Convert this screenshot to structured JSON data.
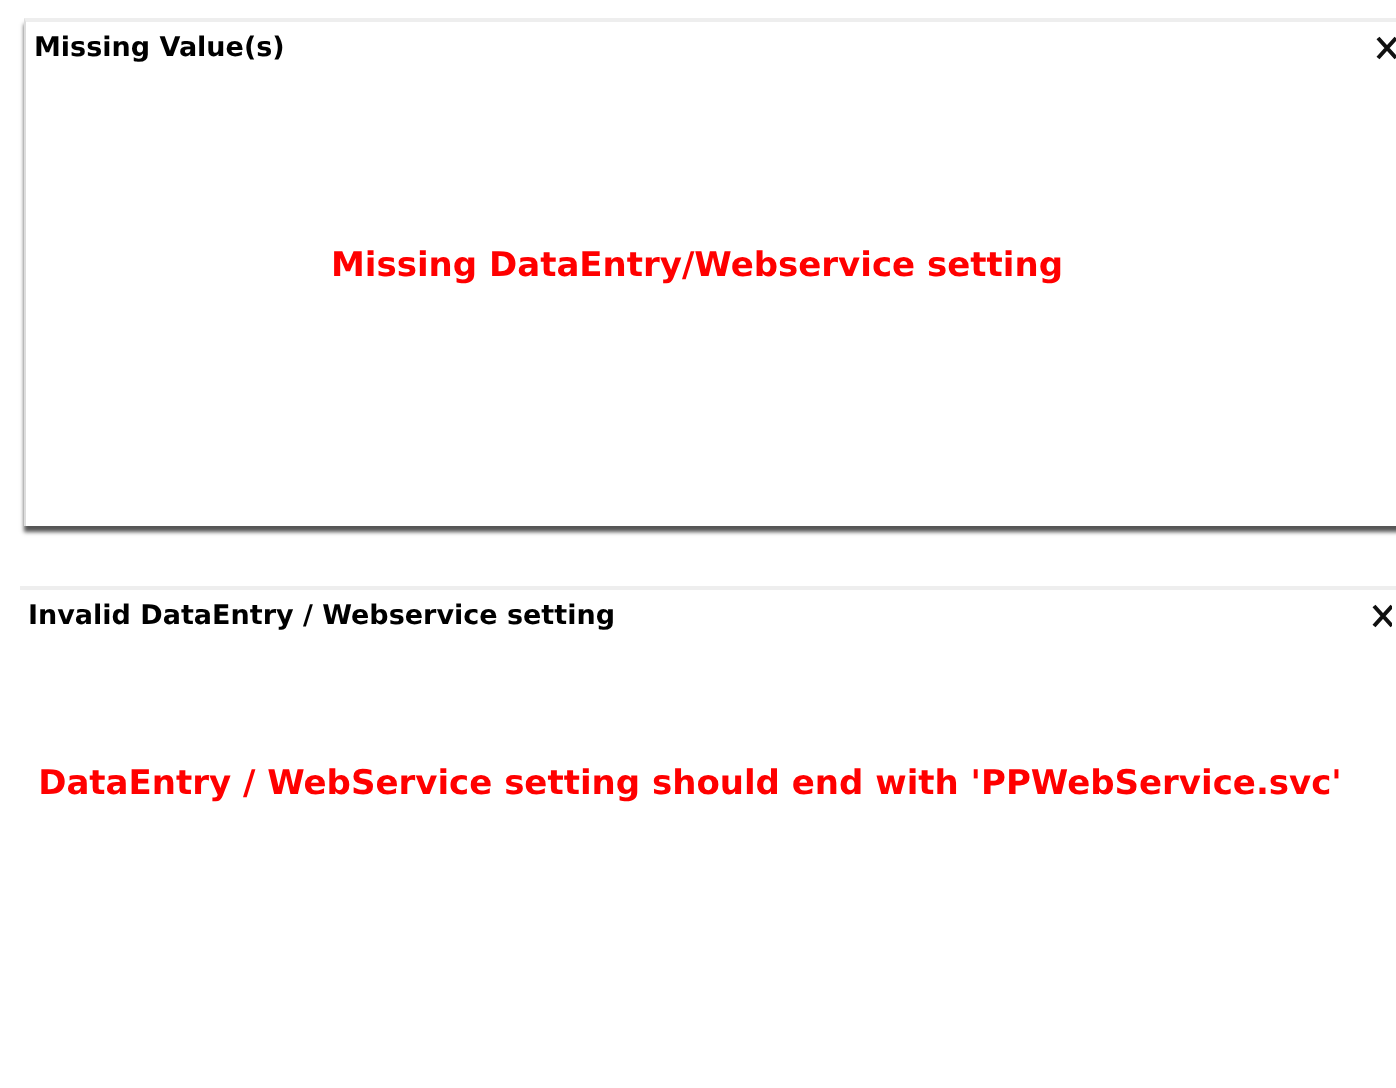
{
  "dialogs": [
    {
      "title": "Missing Value(s)",
      "message": "Missing DataEntry/Webservice setting"
    },
    {
      "title": "Invalid DataEntry / Webservice setting",
      "message": "DataEntry / WebService setting should end with 'PPWebService.svc'"
    }
  ]
}
